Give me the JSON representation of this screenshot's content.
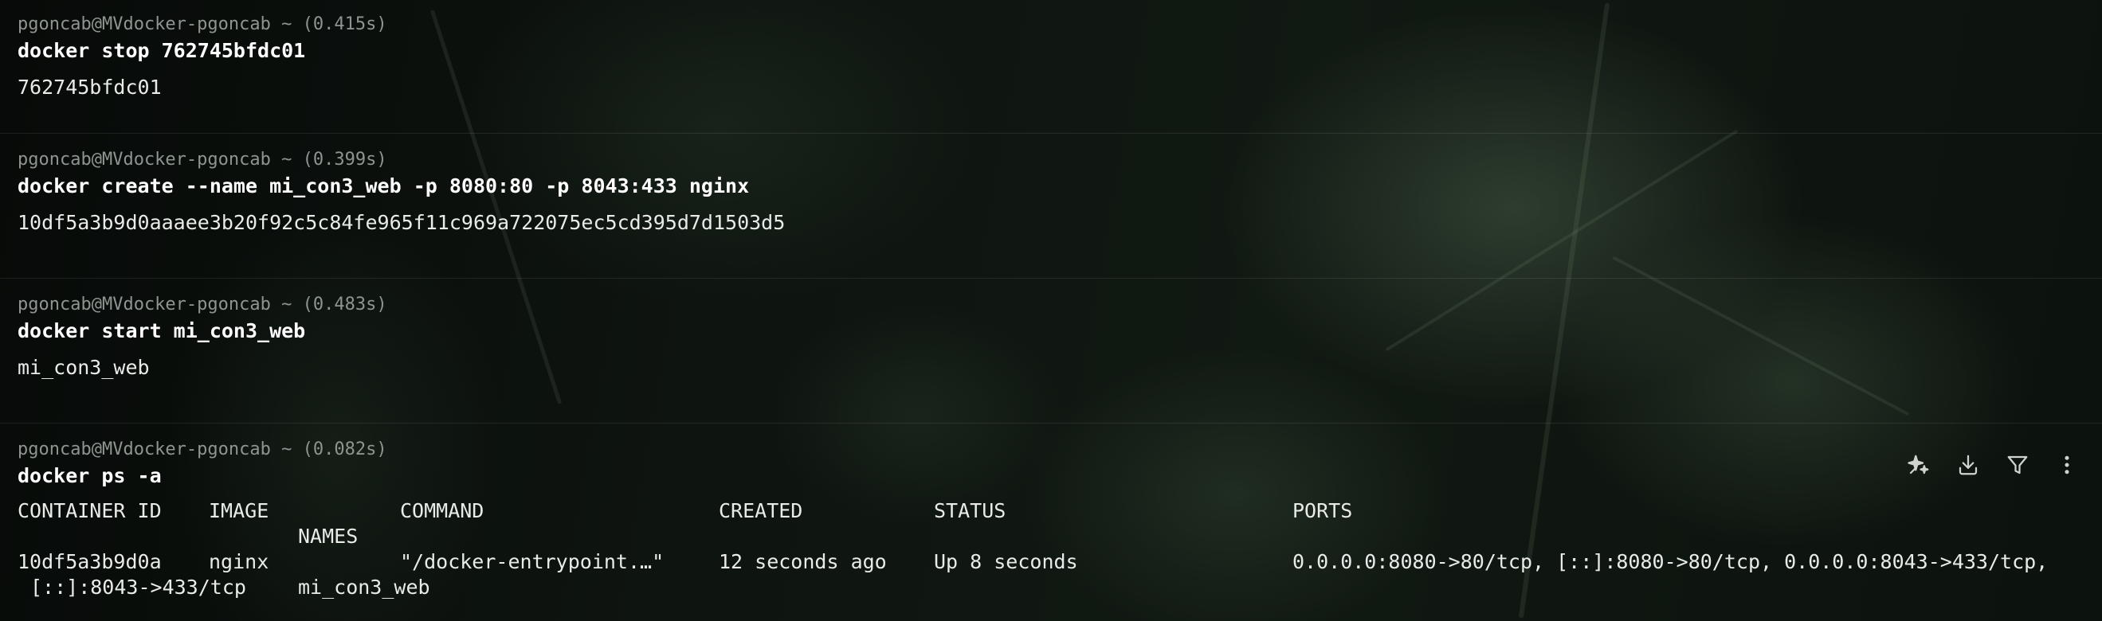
{
  "blocks": [
    {
      "prompt": "pgoncab@MVdocker-pgoncab ~ (0.415s)",
      "command": "docker stop 762745bfdc01",
      "output": "762745bfdc01"
    },
    {
      "prompt": "pgoncab@MVdocker-pgoncab ~ (0.399s)",
      "command": "docker create --name mi_con3_web -p 8080:80 -p 8043:433 nginx",
      "output": "10df5a3b9d0aaaee3b20f92c5c84fe965f11c969a722075ec5cd395d7d1503d5"
    },
    {
      "prompt": "pgoncab@MVdocker-pgoncab ~ (0.483s)",
      "command": "docker start mi_con3_web",
      "output": "mi_con3_web"
    },
    {
      "prompt": "pgoncab@MVdocker-pgoncab ~ (0.082s)",
      "command": "docker ps -a",
      "table": {
        "headers": {
          "container_id": "CONTAINER ID",
          "image": "IMAGE",
          "command": "COMMAND",
          "created": "CREATED",
          "status": "STATUS",
          "ports": "PORTS",
          "names": "NAMES"
        },
        "rows": [
          {
            "container_id": "10df5a3b9d0a",
            "image": "nginx",
            "command": "\"/docker-entrypoint.…\"",
            "created": "12 seconds ago",
            "status": "Up 8 seconds",
            "ports": "0.0.0.0:8080->80/tcp, [::]:8080->80/tcp, 0.0.0.0:8043->433/tcp,",
            "ports_cont": "[::]:8043->433/tcp",
            "names": "mi_con3_web"
          }
        ]
      }
    }
  ],
  "toolbar": {
    "icons": [
      "sparkle-icon",
      "download-icon",
      "filter-icon",
      "more-vertical-icon"
    ]
  }
}
